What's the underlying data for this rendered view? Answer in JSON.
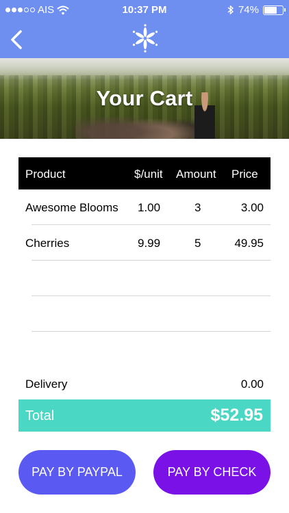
{
  "status_bar": {
    "carrier": "AIS",
    "time": "10:37 PM",
    "battery": "74%",
    "battery_level": 0.74,
    "icons": [
      "signal-dots-icon",
      "wifi-icon",
      "bluetooth-icon",
      "battery-icon"
    ]
  },
  "nav": {
    "back_icon": "chevron-left-icon",
    "logo_icon": "flower-logo-icon"
  },
  "hero": {
    "title": "Your Cart"
  },
  "table": {
    "headers": {
      "product": "Product",
      "unit": "$/unit",
      "amount": "Amount",
      "price": "Price"
    },
    "rows": [
      {
        "product": "Awesome Blooms",
        "unit": "1.00",
        "amount": "3",
        "price": "3.00"
      },
      {
        "product": "Cherries",
        "unit": "9.99",
        "amount": "5",
        "price": "49.95"
      },
      {
        "product": "",
        "unit": "",
        "amount": "",
        "price": ""
      },
      {
        "product": "",
        "unit": "",
        "amount": "",
        "price": ""
      }
    ]
  },
  "summary": {
    "delivery_label": "Delivery",
    "delivery_value": "0.00",
    "total_label": "Total",
    "total_value": "$52.95"
  },
  "buttons": {
    "paypal": "PAY BY PAYPAL",
    "check": "PAY BY CHECK"
  },
  "colors": {
    "nav_background": "#6f8ff0",
    "header_background": "#000000",
    "total_background": "#4ad7c3",
    "paypal_button": "#5a5af3",
    "check_button": "#7a12e8"
  }
}
